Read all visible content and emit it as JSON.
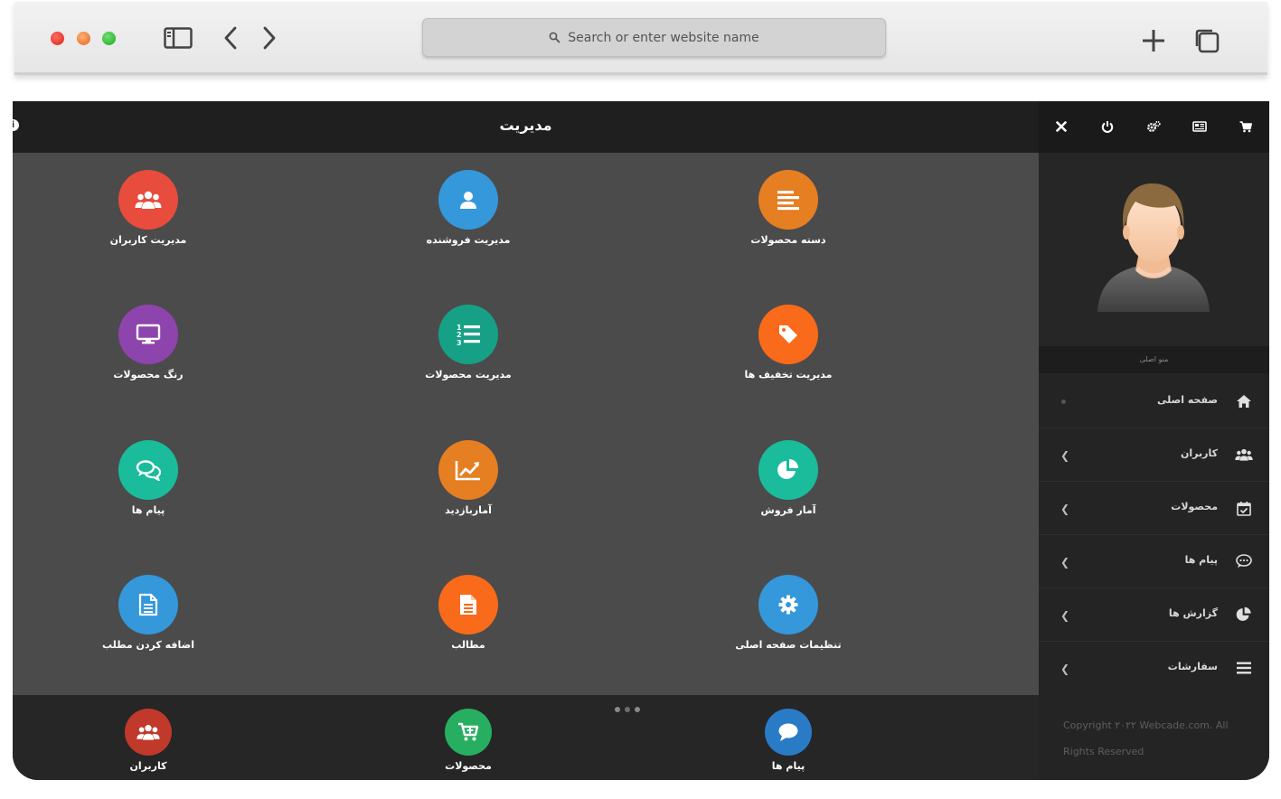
{
  "browser": {
    "url_placeholder": "Search or enter website name"
  },
  "header": {
    "title": "مدیریت",
    "info_icon": "i"
  },
  "tiles": [
    {
      "label": "دسته محصولات",
      "icon": "align-left-icon",
      "color": "#e67e22"
    },
    {
      "label": "مدیریت فروشنده",
      "icon": "user-icon",
      "color": "#3498db"
    },
    {
      "label": "مدیریت کاربران",
      "icon": "users-icon",
      "color": "#e74c3c"
    },
    {
      "label": "مدیریت تخفیف ها",
      "icon": "tag-icon",
      "color": "#f96a1a"
    },
    {
      "label": "مدیریت محصولات",
      "icon": "ordered-list-icon",
      "color": "#16a085"
    },
    {
      "label": "رنگ محصولات",
      "icon": "monitor-icon",
      "color": "#8e44ad"
    },
    {
      "label": "آمار فروش",
      "icon": "pie-chart-icon",
      "color": "#1abc9c"
    },
    {
      "label": "آماربازدید",
      "icon": "line-chart-icon",
      "color": "#e67e22"
    },
    {
      "label": "پیام ها",
      "icon": "comments-icon",
      "color": "#1abc9c"
    },
    {
      "label": "تنظیمات صفحه اصلی",
      "icon": "gear-icon",
      "color": "#3498db"
    },
    {
      "label": "مطالب",
      "icon": "file-icon",
      "color": "#f96a1a"
    },
    {
      "label": "اضافه کردن مطلب",
      "icon": "file-text-icon",
      "color": "#3498db"
    }
  ],
  "dock": [
    {
      "label": "پیام ها",
      "icon": "comment-icon",
      "color": "#2a7bc6"
    },
    {
      "label": "محصولات",
      "icon": "cart-plus-icon",
      "color": "#27ae60"
    },
    {
      "label": "کاربران",
      "icon": "users-icon",
      "color": "#c0392b"
    }
  ],
  "sidebar": {
    "menu_title": "منو اصلی",
    "items": [
      {
        "label": "صفحه اصلی",
        "icon": "home-icon"
      },
      {
        "label": "کاربران",
        "icon": "users-icon"
      },
      {
        "label": "محصولات",
        "icon": "calendar-check-icon"
      },
      {
        "label": "پیام ها",
        "icon": "comment-dots-icon"
      },
      {
        "label": "گزارش ها",
        "icon": "pie-chart-icon"
      },
      {
        "label": "سفارشات",
        "icon": "bars-icon"
      }
    ],
    "copyright": "Copyright ۲۰۲۲ Webcade.com. All Rights Reserved"
  }
}
